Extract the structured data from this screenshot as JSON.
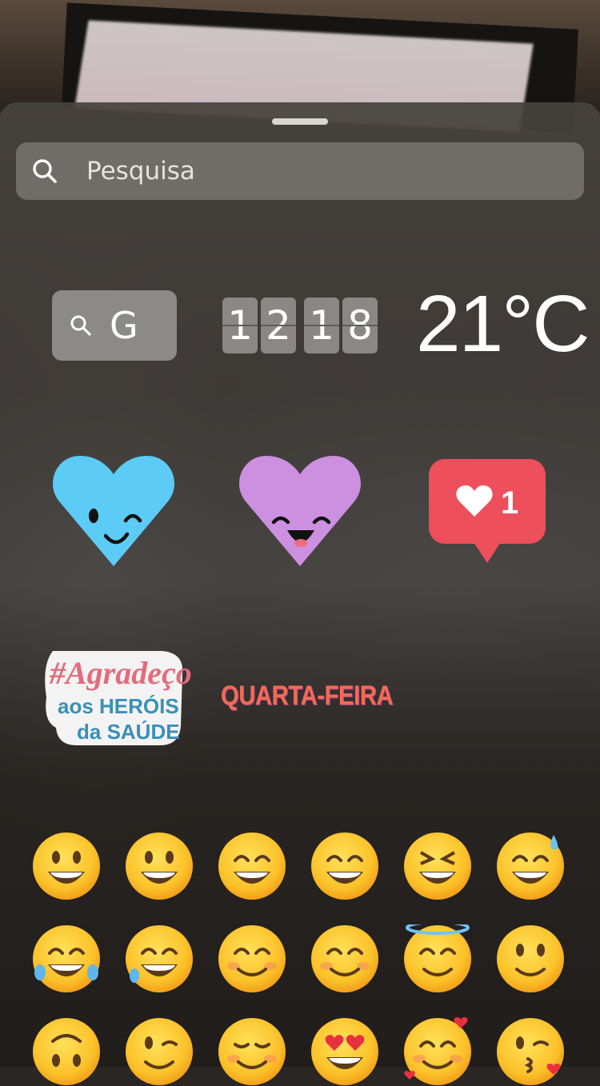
{
  "search": {
    "placeholder": "Pesquisa"
  },
  "stickers": {
    "gif_letter": "G",
    "clock": {
      "hour": "12",
      "minute": "18"
    },
    "temperature": "21°C",
    "like_count": "1",
    "heroes": {
      "line1": "#Agradeço",
      "line2": "aos HERÓIS",
      "line3": "da SAÚDE"
    },
    "weekday": "QUARTA-FEIRA"
  },
  "icons": {
    "search": "search-icon",
    "gif": "gif-search-icon",
    "heart_blue": "winking-blue-heart-sticker",
    "heart_purple": "smiling-purple-heart-sticker",
    "like": "heart-like-bubble"
  },
  "colors": {
    "heart_blue": "#5ccbf5",
    "heart_purple": "#cd8fe0",
    "like_bubble": "#ee4f5c"
  },
  "emoji_rows": [
    [
      "😀",
      "😃",
      "😄",
      "😁",
      "😆",
      "😅"
    ],
    [
      "😂",
      "🤣",
      "☺️",
      "😊",
      "😇",
      "🙂"
    ],
    [
      "🙃",
      "😉",
      "😌",
      "😍",
      "🥰",
      "😘"
    ]
  ]
}
